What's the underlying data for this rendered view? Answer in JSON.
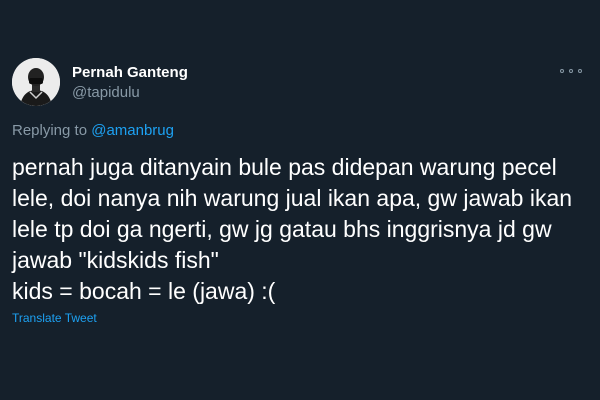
{
  "tweet": {
    "display_name": "Pernah Ganteng",
    "handle": "@tapidulu",
    "replying_prefix": "Replying to ",
    "replying_mention": "@amanbrug",
    "text": "pernah juga ditanyain bule pas didepan warung pecel\nlele, doi nanya nih warung jual ikan apa, gw jawab ikan\nlele tp doi ga ngerti, gw jg gatau bhs inggrisnya jd gw\njawab \"kidskids fish\"\nkids = bocah = le (jawa) :(",
    "translate_label": "Translate Tweet"
  },
  "icons": {
    "avatar": "profile-photo",
    "more": "more-options-icon"
  },
  "colors": {
    "background": "#15202b",
    "primary_text": "#ffffff",
    "secondary_text": "#8899a6",
    "link": "#1da1f2"
  }
}
